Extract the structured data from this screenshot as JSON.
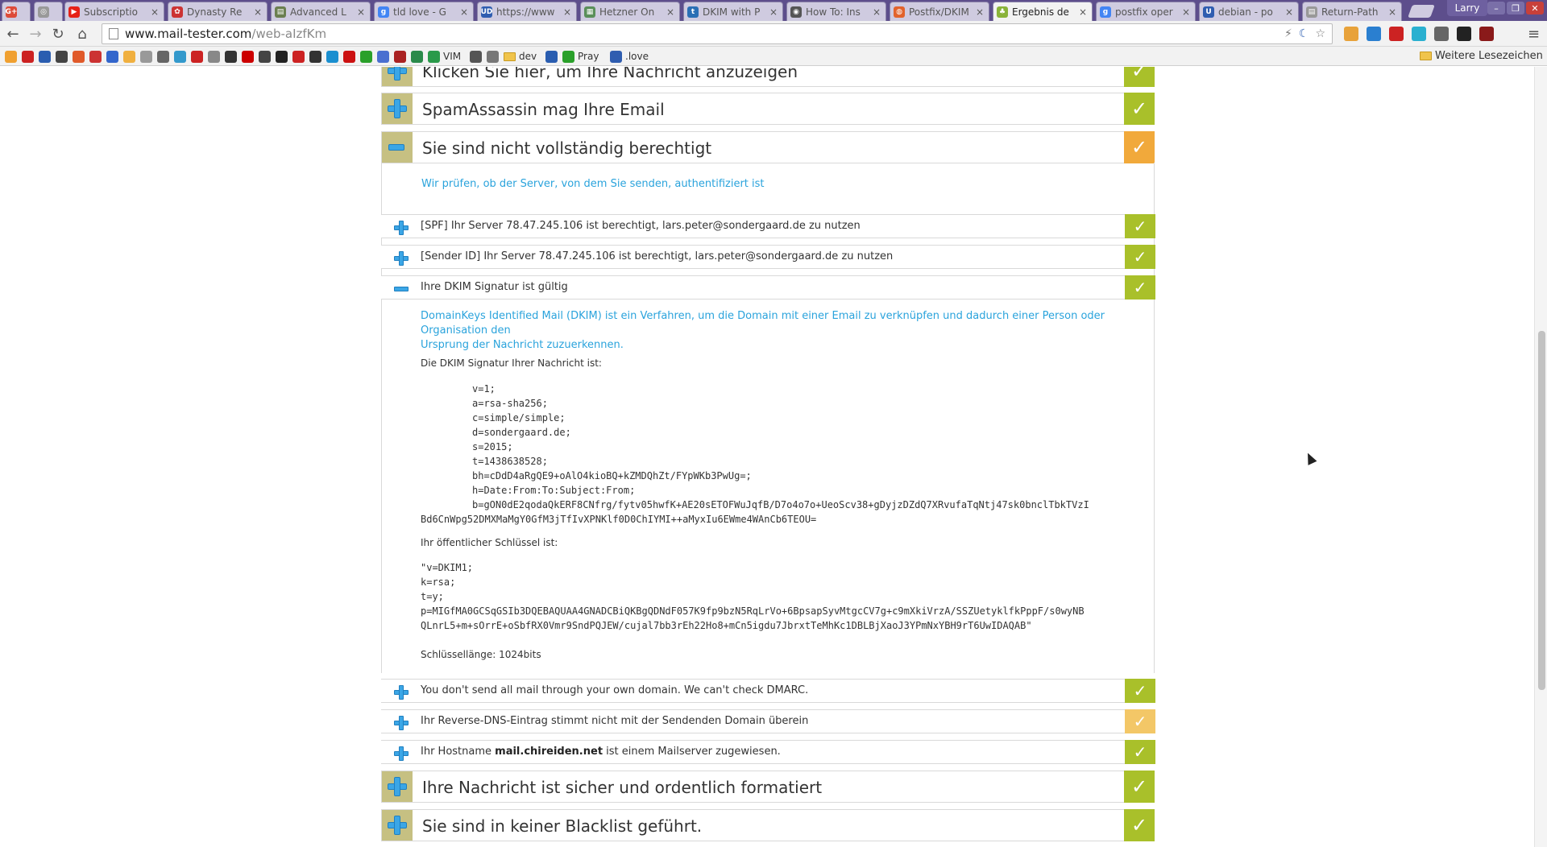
{
  "browser": {
    "tabs": [
      {
        "label": "",
        "color": "#dd4b39",
        "icon": "G+"
      },
      {
        "label": "",
        "color": "#999999",
        "icon": "◎"
      },
      {
        "label": "Subscriptio",
        "color": "#e62117",
        "icon": "▶"
      },
      {
        "label": "Dynasty Re",
        "color": "#cc3333",
        "icon": "✿"
      },
      {
        "label": "Advanced L",
        "color": "#6b7f50",
        "icon": "▤"
      },
      {
        "label": "tld love - G",
        "color": "#4285f4",
        "icon": "g"
      },
      {
        "label": "https://www",
        "color": "#2f5db0",
        "icon": "UD"
      },
      {
        "label": "Hetzner On",
        "color": "#5a8f5a",
        "icon": "▦"
      },
      {
        "label": "DKIM with P",
        "color": "#2a6fb5",
        "icon": "t"
      },
      {
        "label": "How To: Ins",
        "color": "#555555",
        "icon": "◉"
      },
      {
        "label": "Postfix/DKIM",
        "color": "#e2632c",
        "icon": "◍"
      },
      {
        "label": "Ergebnis de",
        "color": "#8ab33a",
        "icon": "♣",
        "active": true
      },
      {
        "label": "postfix oper",
        "color": "#4285f4",
        "icon": "g"
      },
      {
        "label": "debian - po",
        "color": "#2f5db0",
        "icon": "U"
      },
      {
        "label": "Return-Path",
        "color": "#999999",
        "icon": "▤"
      }
    ],
    "profile_name": "Larry",
    "url_host": "www.mail-tester.com",
    "url_path": "/web-aIzfKm",
    "bookmarks": [
      {
        "label": "",
        "color": "#f0a030"
      },
      {
        "label": "",
        "color": "#cc2222"
      },
      {
        "label": "",
        "color": "#2a5db0"
      },
      {
        "label": "",
        "color": "#444444"
      },
      {
        "label": "",
        "color": "#e05a2a"
      },
      {
        "label": "",
        "color": "#cc3333"
      },
      {
        "label": "",
        "color": "#3366cc"
      },
      {
        "label": "",
        "color": "#f0b040"
      },
      {
        "label": "",
        "color": "#999999"
      },
      {
        "label": "",
        "color": "#666666"
      },
      {
        "label": "",
        "color": "#3399cc"
      },
      {
        "label": "",
        "color": "#cc2222"
      },
      {
        "label": "",
        "color": "#888888"
      },
      {
        "label": "",
        "color": "#333333"
      },
      {
        "label": "",
        "color": "#cc0000"
      },
      {
        "label": "",
        "color": "#444444"
      },
      {
        "label": "",
        "color": "#222222"
      },
      {
        "label": "",
        "color": "#cc2222"
      },
      {
        "label": "",
        "color": "#333333"
      },
      {
        "label": "",
        "color": "#1a8fd0"
      },
      {
        "label": "",
        "color": "#cc1111"
      },
      {
        "label": "",
        "color": "#2aa02a"
      },
      {
        "label": "",
        "color": "#4a6fd0"
      },
      {
        "label": "",
        "color": "#aa2222"
      },
      {
        "label": "",
        "color": "#2a8a4a"
      },
      {
        "label": "VIM",
        "color": "#2a9a4a"
      },
      {
        "label": "",
        "color": "#555555"
      },
      {
        "label": "",
        "color": "#777777"
      },
      {
        "label": "dev",
        "color": "#f0c44c",
        "folder": true
      },
      {
        "label": "",
        "color": "#2a5db0"
      },
      {
        "label": "Pray",
        "color": "#2aa02a"
      },
      {
        "label": ".love",
        "color": "#2f5db0"
      }
    ],
    "more_bookmarks": "Weitere Lesezeichen"
  },
  "page": {
    "sections": [
      {
        "title": "Klicken Sie hier, um Ihre Nachricht anzuzeigen",
        "status": "green",
        "expanded": false
      },
      {
        "title": "SpamAssassin mag Ihre Email",
        "status": "green",
        "expanded": false
      },
      {
        "title": "Sie sind nicht vollständig berechtigt",
        "status": "orange",
        "expanded": true
      },
      {
        "title": "Ihre Nachricht ist sicher und ordentlich formatiert",
        "status": "green",
        "expanded": false
      },
      {
        "title": "Sie sind in keiner Blacklist geführt.",
        "status": "green",
        "expanded": false
      }
    ],
    "auth_description": "Wir prüfen, ob der Server, von dem Sie senden, authentifiziert ist",
    "auth_checks": [
      {
        "text": "[SPF] Ihr Server 78.47.245.106 ist berechtigt, lars.peter@sondergaard.de zu nutzen",
        "status": "green"
      },
      {
        "text": "[Sender ID] Ihr Server 78.47.245.106 ist berechtigt, lars.peter@sondergaard.de zu nutzen",
        "status": "green"
      },
      {
        "text": "Ihre DKIM Signatur ist gültig",
        "status": "green",
        "expanded": true
      },
      {
        "text": "You don't send all mail through your own domain. We can't check DMARC.",
        "status": "green"
      },
      {
        "text": "Ihr Reverse-DNS-Eintrag stimmt nicht mit der Sendenden Domain überein",
        "status": "lightorange"
      },
      {
        "text_before": "Ihr Hostname ",
        "text_bold": "mail.chireiden.net",
        "text_after": " ist einem Mailserver zugewiesen.",
        "status": "green"
      }
    ],
    "dkim": {
      "description_line1": "DomainKeys Identified Mail (DKIM) ist ein Verfahren, um die Domain mit einer Email zu verknüpfen und dadurch einer Person oder Organisation den",
      "description_line2": "Ursprung der Nachricht zuzuerkennen.",
      "signature_label": "Die DKIM Signatur Ihrer Nachricht ist:",
      "signature_lines": [
        "v=1;",
        "a=rsa-sha256;",
        "c=simple/simple;",
        "d=sondergaard.de;",
        "s=2015;",
        "t=1438638528;",
        "bh=cDdD4aRgQE9+oAlO4kioBQ+kZMDQhZt/FYpWKb3PwUg=;",
        "h=Date:From:To:Subject:From;",
        "b=gON0dE2qodaQkERF8CNfrg/fytv05hwfK+AE20sETOFWuJqfB/D7o4o7o+UeoScv38+gDyjzDZdQ7XRvufaTqNtj47sk0bnclTbkTVzI"
      ],
      "signature_wrap": "Bd6CnWpg52DMXMaMgY0GfM3jTfIvXPNKlf0D0ChIYMI++aMyxIu6EWme4WAnCb6TEOU=",
      "public_key_label": "Ihr öffentlicher Schlüssel ist:",
      "public_key_lines": [
        "\"v=DKIM1;",
        "k=rsa;",
        "t=y;",
        "p=MIGfMA0GCSqGSIb3DQEBAQUAA4GNADCBiQKBgQDNdF057K9fp9bzN5RqLrVo+6BpsapSyvMtgcCV7g+c9mXkiVrzA/SSZUetyklfkPppF/s0wyNB",
        "QLnrL5+m+sOrrE+oSbfRX0Vmr9SndPQJEW/cujal7bb3rEh22Ho8+mCn5igdu7JbrxtTeMhKc1DBLBjXaoJ3YPmNxYBH9rT6UwIDAQAB\""
      ],
      "key_length": "Schlüssellänge: 1024bits"
    }
  }
}
